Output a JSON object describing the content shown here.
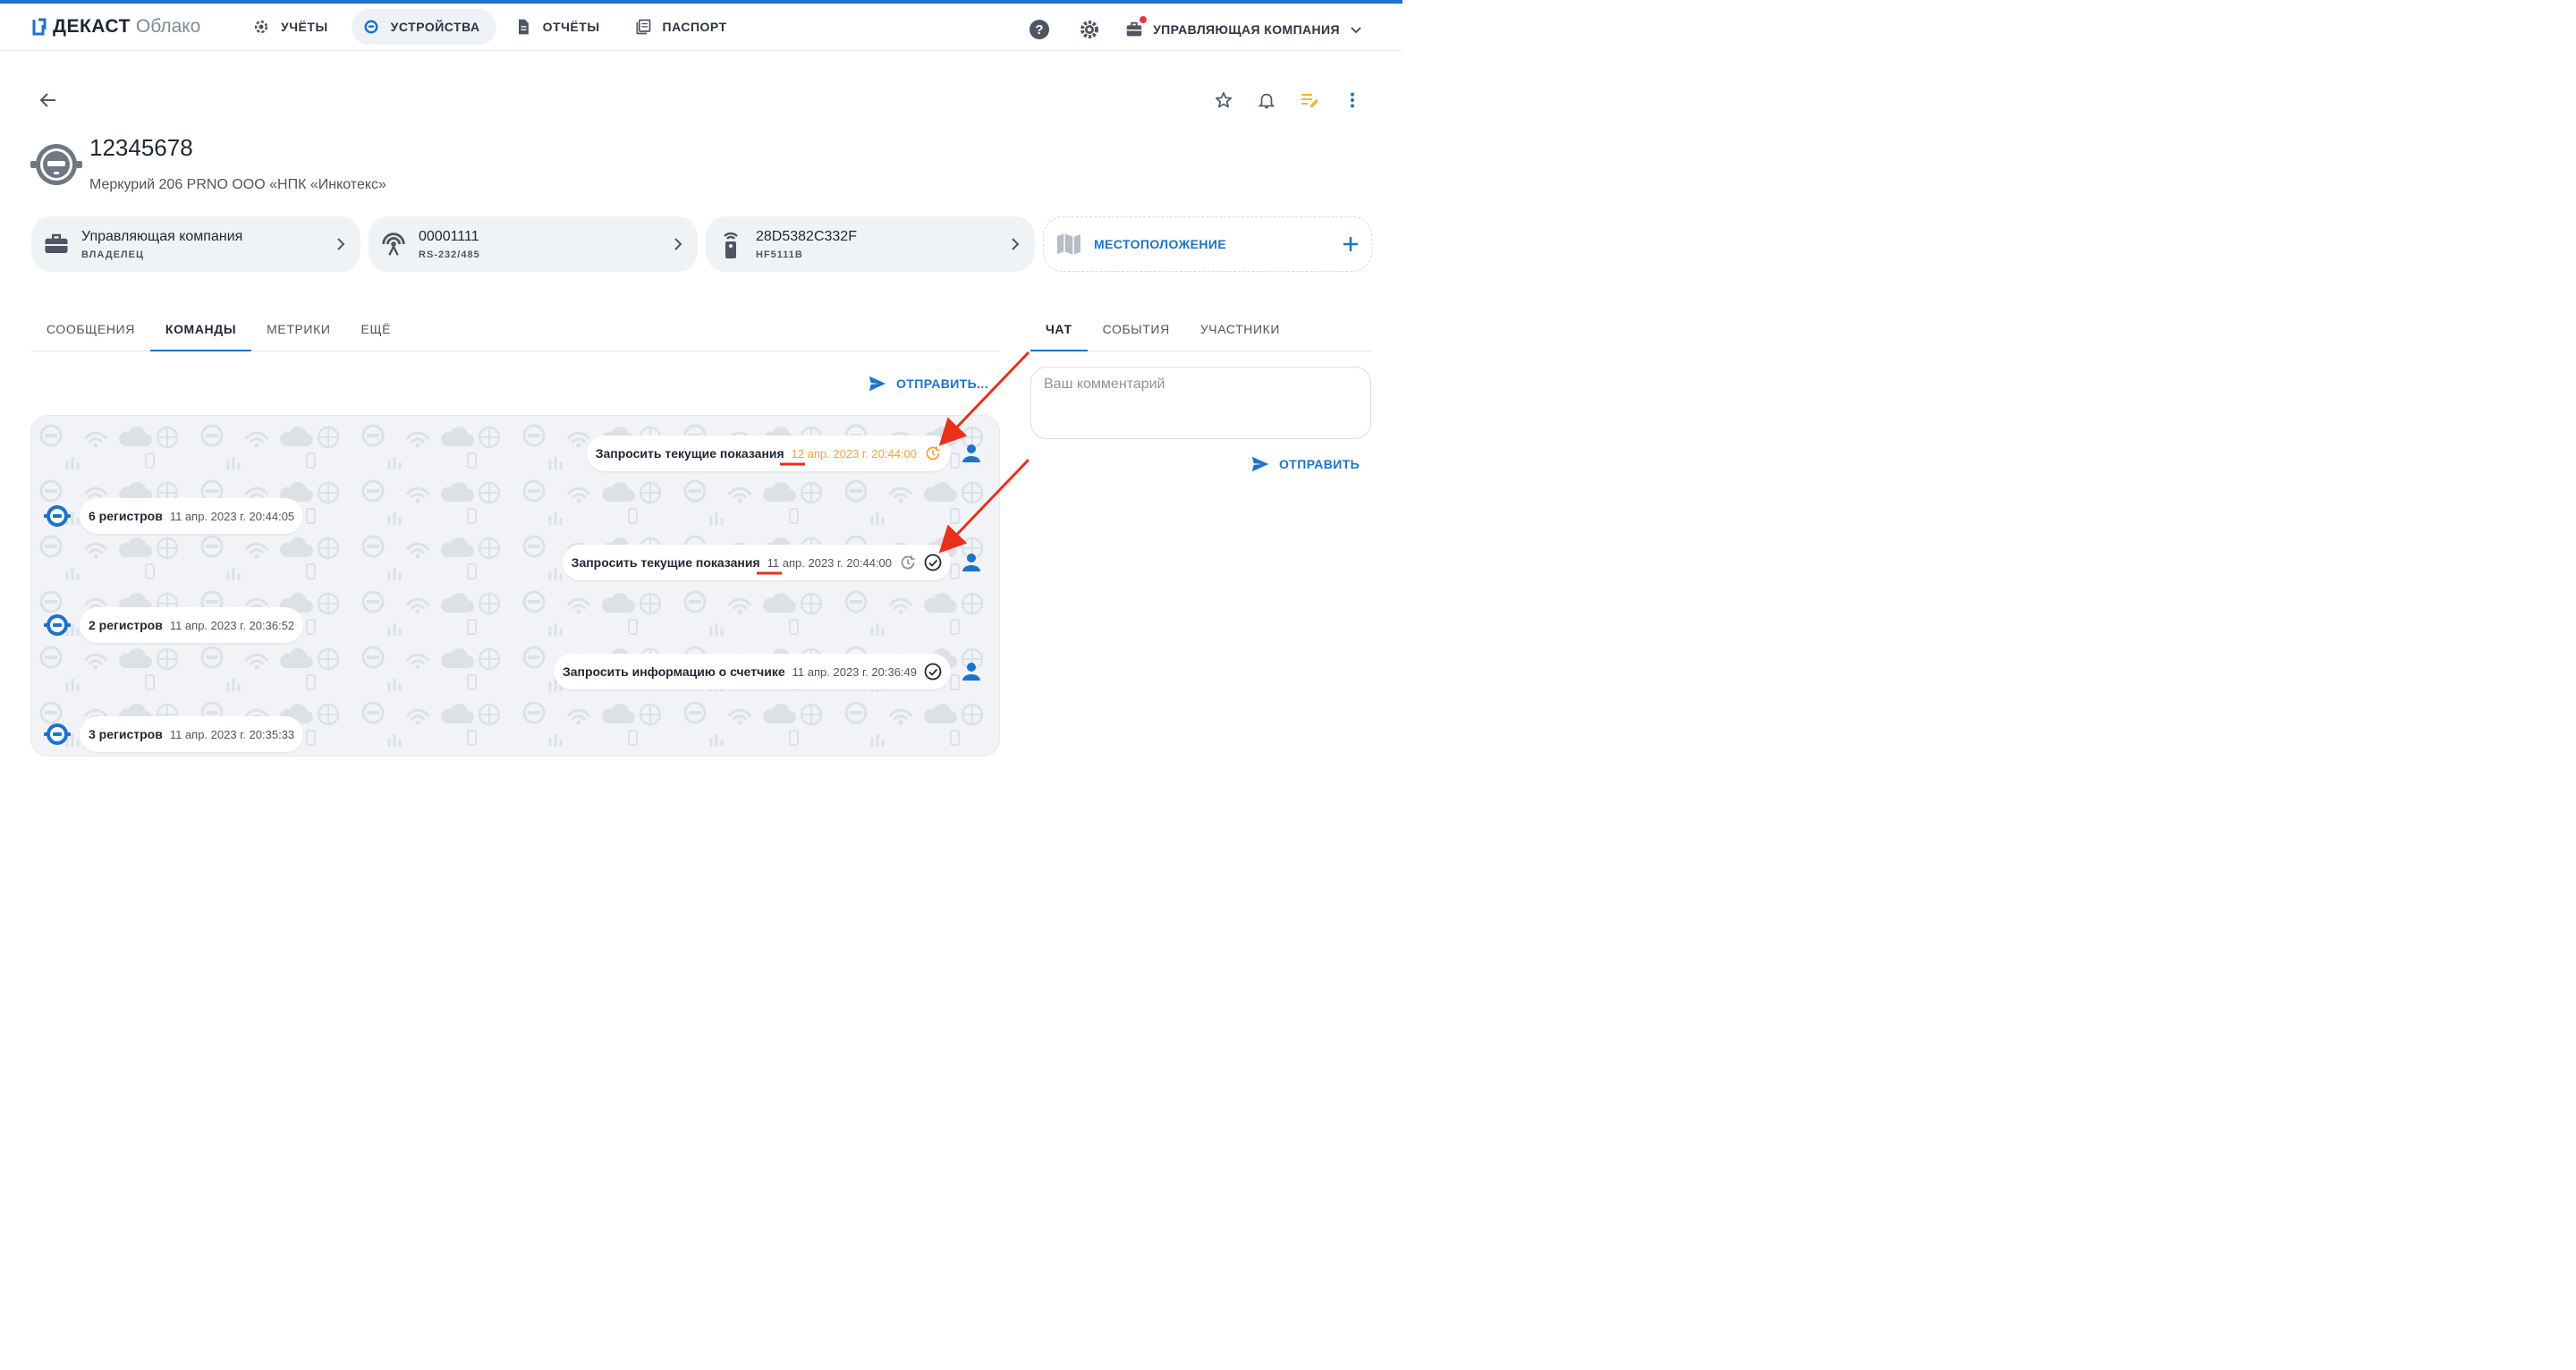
{
  "brand": {
    "name": "ДЕКАСТ",
    "sub": "Облако"
  },
  "nav": [
    {
      "label": "УЧЁТЫ",
      "icon": "gear-outline-icon"
    },
    {
      "label": "УСТРОЙСТВА",
      "icon": "meter-icon",
      "active": true
    },
    {
      "label": "ОТЧЁТЫ",
      "icon": "document-icon"
    },
    {
      "label": "ПАСПОРТ",
      "icon": "passport-icon"
    }
  ],
  "header_right": {
    "company": "УПРАВЛЯЮЩАЯ КОМПАНИЯ"
  },
  "device": {
    "id": "12345678",
    "model": "Меркурий 206 PRNO ООО «НПК «Инкотекс»"
  },
  "cards": [
    {
      "main": "Управляющая компания",
      "sub": "ВЛАДЕЛЕЦ",
      "icon": "briefcase-icon"
    },
    {
      "main": "00001111",
      "sub": "RS-232/485",
      "icon": "antenna-icon"
    },
    {
      "main": "28D5382C332F",
      "sub": "HF5111B",
      "icon": "remote-icon"
    },
    {
      "main": "МЕСТОПОЛОЖЕНИЕ",
      "icon": "map-icon"
    }
  ],
  "tabs_left": [
    "СООБЩЕНИЯ",
    "КОМАНДЫ",
    "МЕТРИКИ",
    "ЕЩЁ"
  ],
  "tabs_right": [
    "ЧАТ",
    "СОБЫТИЯ",
    "УЧАСТНИКИ"
  ],
  "send_command_label": "ОТПРАВИТЬ...",
  "messages": [
    {
      "side": "out",
      "text": "Запросить текущие показания",
      "time": "12 апр. 2023 г. 20:44:00",
      "status": "pending"
    },
    {
      "side": "in",
      "text": "6 регистров",
      "time": "11 апр. 2023 г. 20:44:05"
    },
    {
      "side": "out",
      "text": "Запросить текущие показания",
      "time": "11 апр. 2023 г. 20:44:00",
      "status": "done-with-history"
    },
    {
      "side": "in",
      "text": "2 регистров",
      "time": "11 апр. 2023 г. 20:36:52"
    },
    {
      "side": "out",
      "text": "Запросить информацию о счетчике",
      "time": "11 апр. 2023 г. 20:36:49",
      "status": "done"
    },
    {
      "side": "in",
      "text": "3 регистров",
      "time": "11 апр. 2023 г. 20:35:33"
    }
  ],
  "comment": {
    "placeholder": "Ваш комментарий",
    "value": ""
  },
  "send_comment_label": "ОТПРАВИТЬ",
  "colors": {
    "accent": "#1d73c9",
    "pending": "#f2a33a",
    "annotation": "#e8301c"
  }
}
